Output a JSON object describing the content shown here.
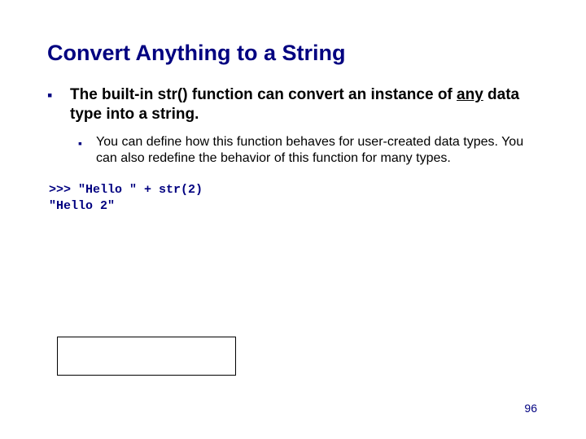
{
  "title": "Convert Anything to a String",
  "bullets": {
    "main_prefix": "The built-in str() function can convert an instance of ",
    "main_underlined": "any",
    "main_suffix": " data type into a string.",
    "sub": "You can define how this function behaves for user-created data types.  You can also redefine the behavior of this function for many types."
  },
  "code": {
    "line1": ">>> \"Hello \" + str(2)",
    "line2": "\"Hello 2\""
  },
  "page_number": "96"
}
